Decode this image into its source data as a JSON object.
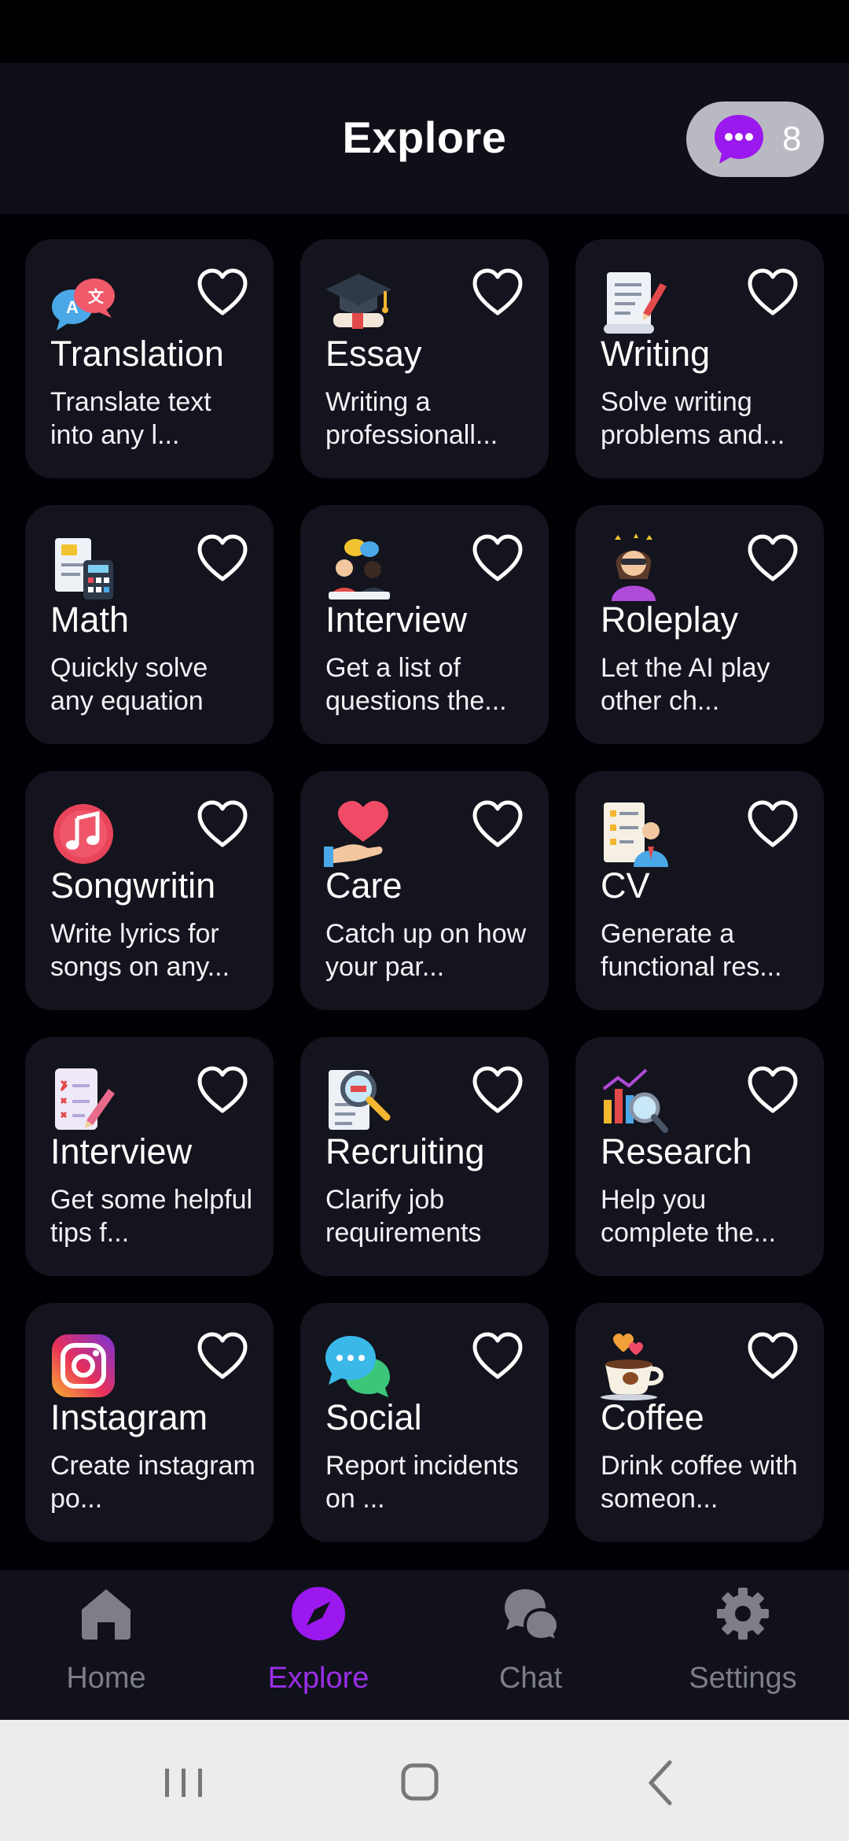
{
  "header": {
    "title": "Explore",
    "credits": "8"
  },
  "colors": {
    "accent": "#9b2ee8",
    "card_bg": "#13141d",
    "nav_inactive": "#7d7e88"
  },
  "cards": [
    {
      "title": "Translation",
      "desc": "Translate text into any l...",
      "icon": "translation-icon"
    },
    {
      "title": "Essay",
      "desc": "Writing a professionall...",
      "icon": "graduation-cap-icon"
    },
    {
      "title": "Writing",
      "desc": "Solve writing problems and...",
      "icon": "document-pen-icon"
    },
    {
      "title": "Math",
      "desc": "Quickly solve any equation",
      "icon": "calculator-icon"
    },
    {
      "title": "Interview",
      "desc": "Get a list of questions the...",
      "icon": "interview-people-icon"
    },
    {
      "title": "Roleplay",
      "desc": "Let the AI play other ch...",
      "icon": "roleplay-person-icon"
    },
    {
      "title": "Songwritin",
      "desc": "Write lyrics for songs on any...",
      "icon": "music-note-icon"
    },
    {
      "title": "Care",
      "desc": "Catch up on how your par...",
      "icon": "heart-hand-icon"
    },
    {
      "title": "CV",
      "desc": "Generate a functional res...",
      "icon": "resume-icon"
    },
    {
      "title": "Interview",
      "desc": "Get some helpful tips f...",
      "icon": "checklist-pen-icon"
    },
    {
      "title": "Recruiting",
      "desc": "Clarify job requirements",
      "icon": "magnifier-document-icon"
    },
    {
      "title": "Research",
      "desc": "Help you complete the...",
      "icon": "chart-magnifier-icon"
    },
    {
      "title": "Instagram",
      "desc": "Create instagram po...",
      "icon": "instagram-icon"
    },
    {
      "title": "Social",
      "desc": "Report incidents on ...",
      "icon": "chat-bubbles-icon"
    },
    {
      "title": "Coffee",
      "desc": "Drink coffee with someon...",
      "icon": "coffee-cup-icon"
    }
  ],
  "nav": [
    {
      "label": "Home",
      "icon": "home-icon"
    },
    {
      "label": "Explore",
      "icon": "compass-icon",
      "active": true
    },
    {
      "label": "Chat",
      "icon": "chat-icon"
    },
    {
      "label": "Settings",
      "icon": "gear-icon"
    }
  ]
}
